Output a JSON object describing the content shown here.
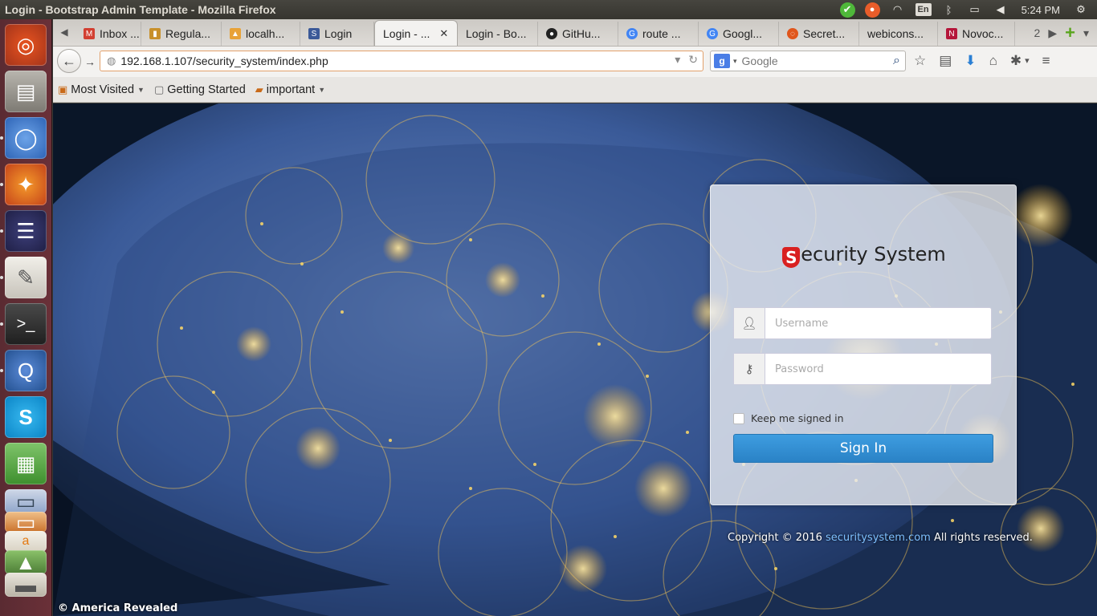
{
  "window": {
    "title": "Login - Bootstrap Admin Template - Mozilla Firefox"
  },
  "panel": {
    "language": "En",
    "time": "5:24 PM",
    "indicators": [
      "check-icon",
      "chat-icon",
      "wifi-icon",
      "language-icon",
      "bluetooth-icon",
      "battery-icon",
      "volume-icon",
      "gear-icon"
    ]
  },
  "launcher": {
    "apps": [
      "ubuntu-dash",
      "files",
      "chromium",
      "firefox",
      "eclipse",
      "text-editor",
      "terminal",
      "quassel",
      "skype",
      "spreadsheet",
      "impress",
      "writer",
      "amazon",
      "image-viewer"
    ]
  },
  "tabs": [
    {
      "label": "Inbox ...",
      "favicon_color": "#d23f31",
      "active": false
    },
    {
      "label": "Regula...",
      "favicon_color": "#c8902a",
      "active": false
    },
    {
      "label": "localh...",
      "favicon_color": "#e8a237",
      "active": false
    },
    {
      "label": "Login",
      "favicon_color": "#3b5998",
      "active": false
    },
    {
      "label": "Login - ...",
      "favicon_color": "",
      "active": true
    },
    {
      "label": "Login - Bo...",
      "favicon_color": "",
      "active": false
    },
    {
      "label": "GitHu...",
      "favicon_color": "#222222",
      "active": false
    },
    {
      "label": "route ...",
      "favicon_color": "#4285f4",
      "active": false
    },
    {
      "label": "Googl...",
      "favicon_color": "#4285f4",
      "active": false
    },
    {
      "label": "Secret...",
      "favicon_color": "#e0561c",
      "active": false
    },
    {
      "label": "webicons...",
      "favicon_color": "",
      "active": false
    },
    {
      "label": "Novoc...",
      "favicon_color": "#b5163a",
      "active": false
    }
  ],
  "tabs_overflow": "2",
  "navbar": {
    "url": "192.168.1.107/security_system/index.php",
    "search_placeholder": "Google"
  },
  "bookmarks": [
    {
      "label": "Most Visited",
      "dropdown": true
    },
    {
      "label": "Getting Started",
      "dropdown": false
    },
    {
      "label": "important",
      "dropdown": true
    }
  ],
  "page": {
    "brand_letter": "S",
    "brand_rest": "ecurity System",
    "username_placeholder": "Username",
    "password_placeholder": "Password",
    "remember_label": "Keep me signed in",
    "signin_label": "Sign In",
    "copyright_prefix": "Copyright © 2016 ",
    "copyright_link": "securitysystem.com",
    "copyright_suffix": " All rights reserved.",
    "image_credit": "© America Revealed"
  },
  "colors": {
    "brand_red": "#d92020",
    "signin_blue": "#2a82c6",
    "launcher": "#6a3038"
  }
}
